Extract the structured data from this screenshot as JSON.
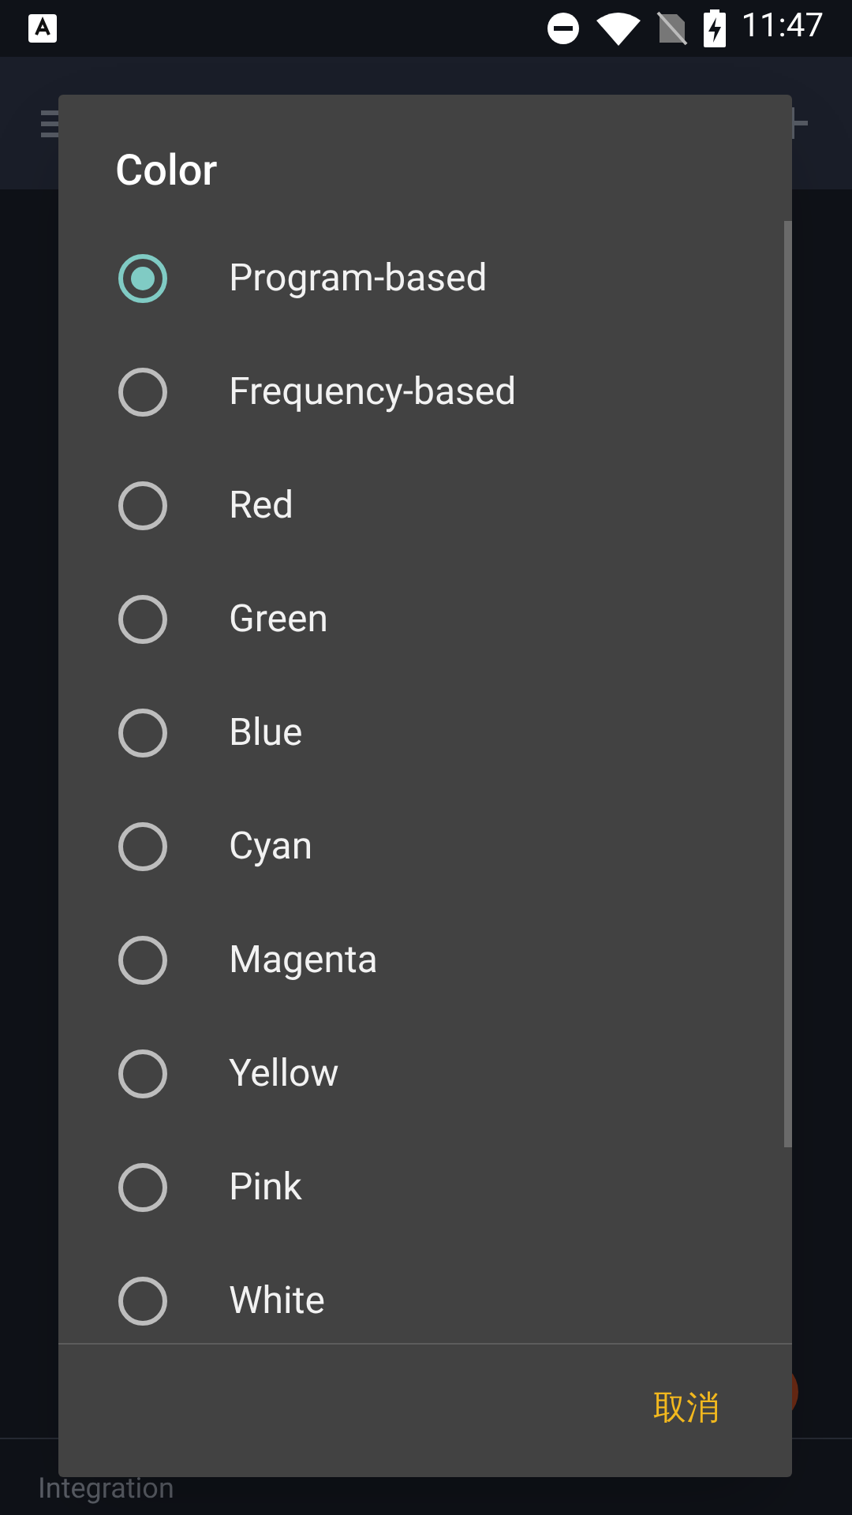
{
  "status_bar": {
    "time": "11:47"
  },
  "background": {
    "section_label": "Integration"
  },
  "dialog": {
    "title": "Color",
    "options": [
      {
        "label": "Program-based",
        "selected": true
      },
      {
        "label": "Frequency-based",
        "selected": false
      },
      {
        "label": "Red",
        "selected": false
      },
      {
        "label": "Green",
        "selected": false
      },
      {
        "label": "Blue",
        "selected": false
      },
      {
        "label": "Cyan",
        "selected": false
      },
      {
        "label": "Magenta",
        "selected": false
      },
      {
        "label": "Yellow",
        "selected": false
      },
      {
        "label": "Pink",
        "selected": false
      },
      {
        "label": "White",
        "selected": false
      }
    ],
    "cancel_button": "取消"
  }
}
